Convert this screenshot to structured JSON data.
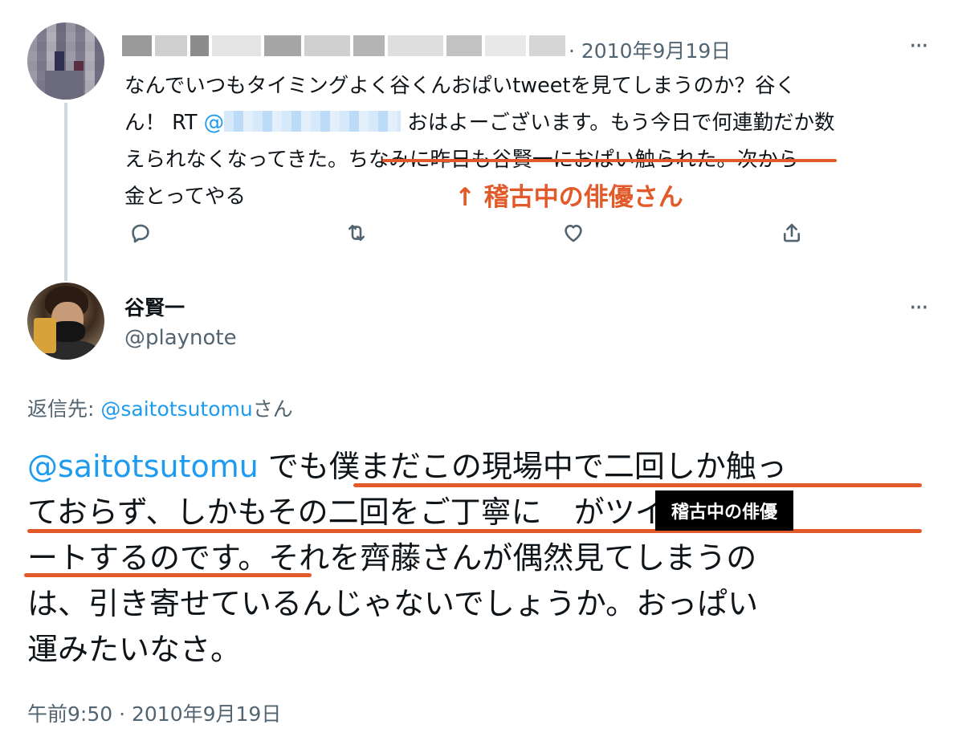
{
  "parent_tweet": {
    "date": "· 2010年9月19日",
    "more": "···",
    "text_1": "なんでいつもタイミングよく谷くんおぱいtweetを見てしまうのか？谷く",
    "text_2a": "ん！ RT ",
    "rt_at": "@",
    "text_2b": " おはよーございます。もう今日で何連勤だか数",
    "text_3a": "えられなくなってきた。",
    "text_3b": "ちなみに昨日も谷賢一におぱい触られた。",
    "text_3c": "次から",
    "text_4": "金とってやる",
    "annotation": "↑ 稽古中の俳優さん",
    "actions": [
      "reply-icon",
      "retweet-icon",
      "like-icon",
      "share-icon"
    ]
  },
  "main_tweet": {
    "name": "谷賢一",
    "handle": "@playnote",
    "more": "···",
    "reply_to_label": "返信先: ",
    "reply_to_user": "@saitotsutomu",
    "reply_to_suffix": "さん",
    "mention": "@saitotsutomu",
    "line1_rest": " でも僕まだこの現場中で二回しか触っ",
    "line2": "ておらず、しかもその二回をご丁寧に",
    "line2_tail": "がツイ",
    "redaction_label": "稽古中の俳優",
    "line3": "ートするのです。それを齊藤さんが偶然見てしまうの",
    "line4": "は、引き寄せているんじゃないでしょうか。おっぱい",
    "line5": "運みたいなさ。",
    "timestamp": "午前9:50 · 2010年9月19日"
  },
  "colors": {
    "link": "#1d9bf0",
    "secondary_text": "#536471",
    "annotation": "#e25a2a",
    "thread_line": "#cfd9de"
  }
}
